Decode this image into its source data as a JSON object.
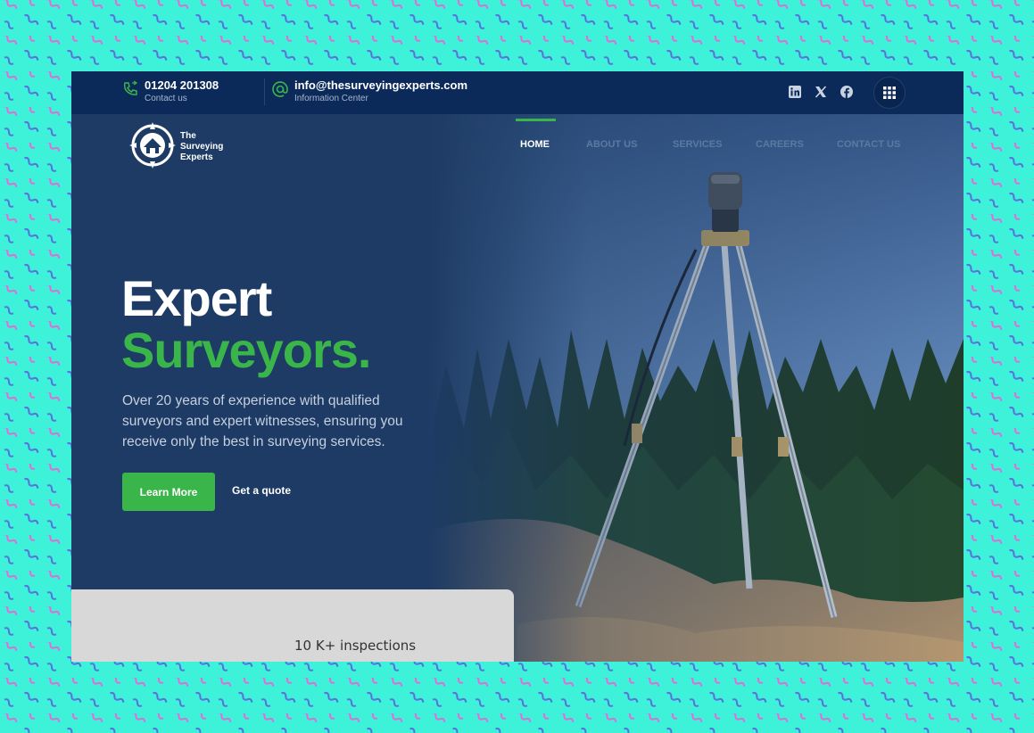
{
  "colors": {
    "page_background": "#3df2d8",
    "squiggle_pink": "#e46ad8",
    "squiggle_blue": "#5a6fe0",
    "topbar": "#0b2a5a",
    "hero_overlay": "#1c3a62",
    "accent_green": "#3ab54a",
    "stats_card": "#d8d8d8"
  },
  "topbar": {
    "phone": {
      "icon": "phone-icon",
      "number": "01204 201308",
      "label": "Contact us"
    },
    "email": {
      "icon": "at-icon",
      "address": "info@thesurveyingexperts.com",
      "label": "Information Center"
    },
    "social": [
      "linkedin-icon",
      "x-icon",
      "facebook-icon"
    ],
    "menu_icon": "grid-icon"
  },
  "logo": {
    "line1": "The",
    "line2": "Surveying",
    "line3": "Experts"
  },
  "nav": {
    "active": "HOME",
    "items": [
      "HOME",
      "ABOUT US",
      "SERVICES",
      "CAREERS",
      "CONTACT US"
    ]
  },
  "hero": {
    "title_line1": "Expert",
    "title_line2": "Surveyors.",
    "description": "Over 20 years of experience with qualified surveyors and expert witnesses, ensuring you receive only the best in surveying services.",
    "primary_button": "Learn More",
    "secondary_link": "Get a quote"
  },
  "stats": {
    "text": "10 K+ inspections"
  }
}
